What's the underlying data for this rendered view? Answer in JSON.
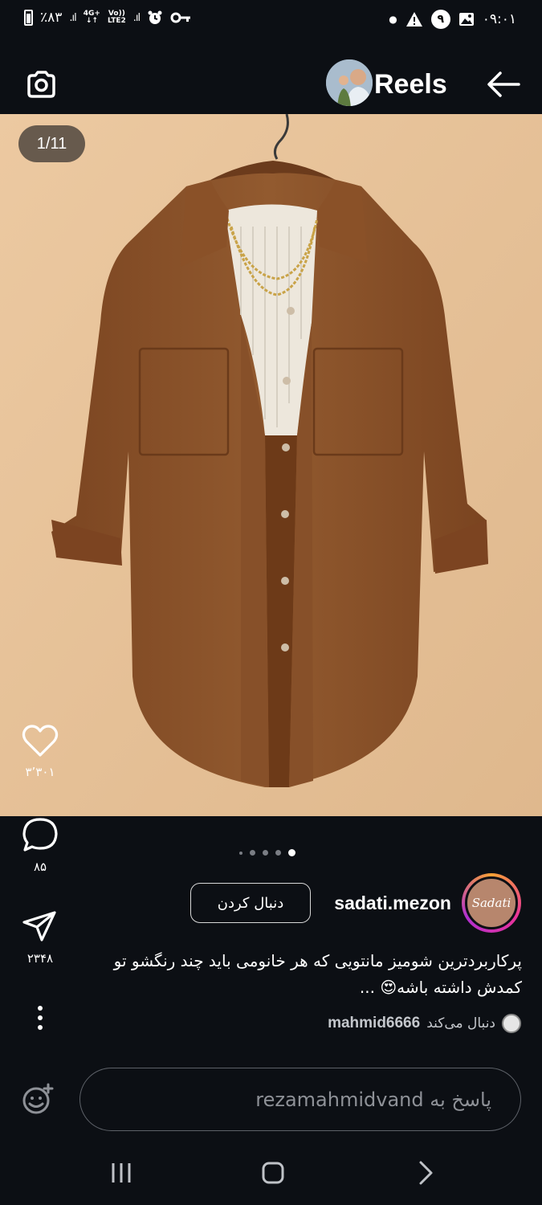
{
  "status_bar": {
    "battery": "٪۸۳",
    "network_top": "4G+",
    "network_left": "Vo))",
    "network_bottom": "LTE2",
    "notification_count": "۹",
    "time": "۰۹:۰۱"
  },
  "header": {
    "title": "Reels"
  },
  "post": {
    "page_counter": "1/11",
    "carousel_total_dots": 5,
    "carousel_active_index": 4
  },
  "actions": {
    "like_count": "۳٬۳۰۱",
    "comment_count": "۸۵",
    "share_count": "۲۳۴۸"
  },
  "author": {
    "username": "sadati.mezon",
    "avatar_text": "Sadati",
    "follow_label": "دنبال کردن"
  },
  "caption": {
    "text": "پرکاربردترین شومیز مانتویی که هر خانومی باید چند رنگشو تو کمدش داشته باشه😍 ..."
  },
  "followed_by": {
    "username": "mahmid6666",
    "label": "دنبال می‌کند"
  },
  "reply": {
    "placeholder": "پاسخ به rezamahmidvand"
  },
  "colors": {
    "background": "#0c0f14",
    "post_background": "#e6c49c",
    "shirt_brown": "#8a5229"
  },
  "icons": {
    "camera": "camera-icon",
    "back": "arrow-left-icon",
    "like": "heart-icon",
    "comment": "comment-bubble-icon",
    "share": "send-icon",
    "more": "more-vertical-icon",
    "emoji": "emoji-add-icon",
    "nav_recents": "recents-icon",
    "nav_home": "home-icon",
    "nav_back": "nav-back-icon"
  }
}
